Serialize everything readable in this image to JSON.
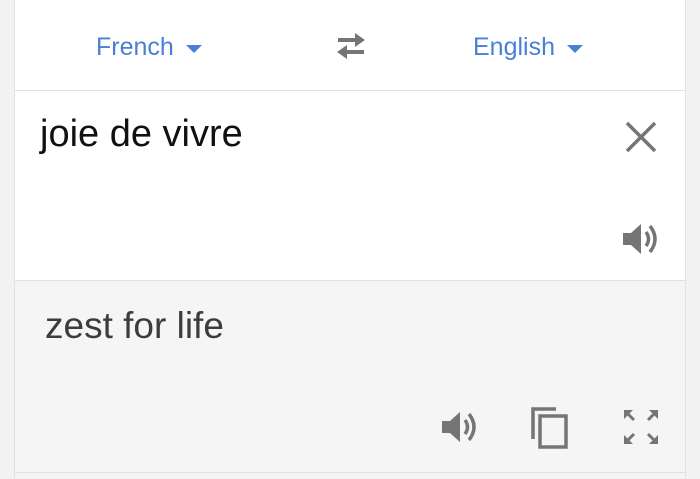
{
  "languages": {
    "source": "French",
    "target": "English"
  },
  "input": {
    "text": "joie de vivre"
  },
  "output": {
    "text": "zest for life"
  },
  "icons": {
    "swap": "swap-arrows-icon",
    "clear": "close-icon",
    "speak": "speaker-icon",
    "copy": "copy-icon",
    "expand": "fullscreen-icon"
  },
  "colors": {
    "accent": "#4a7fd6",
    "icon": "#757575"
  }
}
